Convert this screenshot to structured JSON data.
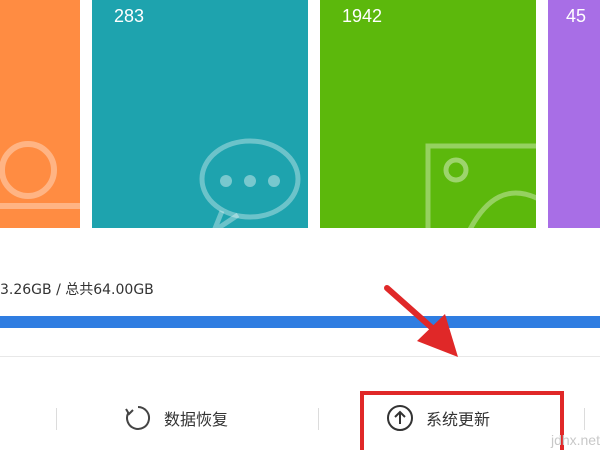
{
  "tiles": [
    {
      "color": "#ff8c42",
      "count": "",
      "icon": "photo-icon"
    },
    {
      "color": "#1ea3ae",
      "count": "283",
      "icon": "message-icon"
    },
    {
      "color": "#5cb80c",
      "count": "1942",
      "icon": "image-icon"
    },
    {
      "color": "#a86ee6",
      "count": "45",
      "icon": "media-icon"
    }
  ],
  "storage": {
    "text": "3.26GB / 总共64.00GB",
    "used_fraction": 1.0,
    "bar_color": "#2f7de1"
  },
  "actions": {
    "data_recovery": {
      "label": "数据恢复",
      "icon": "refresh-icon"
    },
    "system_update": {
      "label": "系统更新",
      "icon": "upload-arrow-icon"
    }
  },
  "annotation": {
    "highlight_color": "#e02828"
  },
  "watermark": "jdhx.net"
}
